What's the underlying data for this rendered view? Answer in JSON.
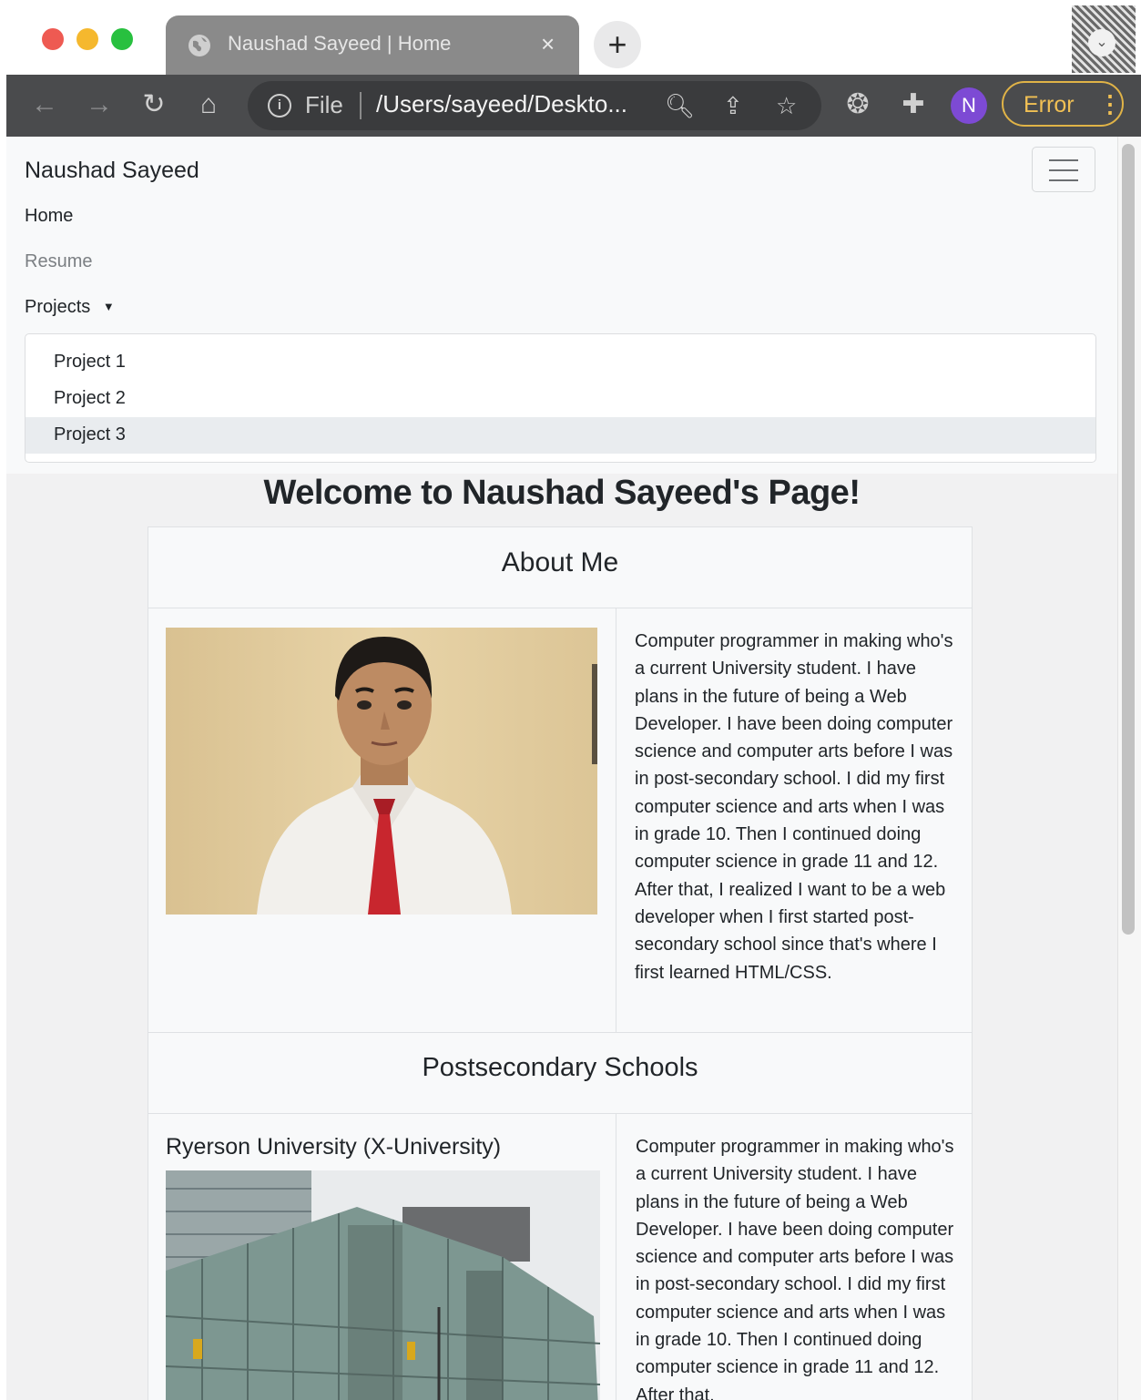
{
  "browser": {
    "tab_title": "Naushad Sayeed | Home",
    "tab_close": "×",
    "new_tab": "+",
    "address": {
      "scheme_label": "File",
      "url": "/Users/sayeed/Deskto..."
    },
    "profile_initial": "N",
    "error_label": "Error"
  },
  "navbar": {
    "brand": "Naushad Sayeed",
    "links": [
      {
        "label": "Home"
      },
      {
        "label": "Resume"
      },
      {
        "label": "Projects"
      }
    ],
    "dropdown": [
      {
        "label": "Project 1"
      },
      {
        "label": "Project 2"
      },
      {
        "label": "Project 3"
      }
    ]
  },
  "page": {
    "welcome": "Welcome to Naushad Sayeed's Page!",
    "about_heading": "About Me",
    "about_text": "Computer programmer in making who's a current University student. I have plans in the future of being a Web Developer. I have been doing computer science and computer arts before I was in post-secondary school. I did my first computer science and arts when I was in grade 10. Then I continued doing computer science in grade 11 and 12. After that, I realized I want to be a web developer when I first started post-secondary school since that's where I first learned HTML/CSS.",
    "schools_heading": "Postsecondary Schools",
    "school_name": "Ryerson University (X-University)",
    "school_text": "Computer programmer in making who's a current University student. I have plans in the future of being a Web Developer. I have been doing computer science and computer arts before I was in post-secondary school. I did my first computer science and arts when I was in grade 10. Then I continued doing computer science in grade 11 and 12. After that,"
  }
}
